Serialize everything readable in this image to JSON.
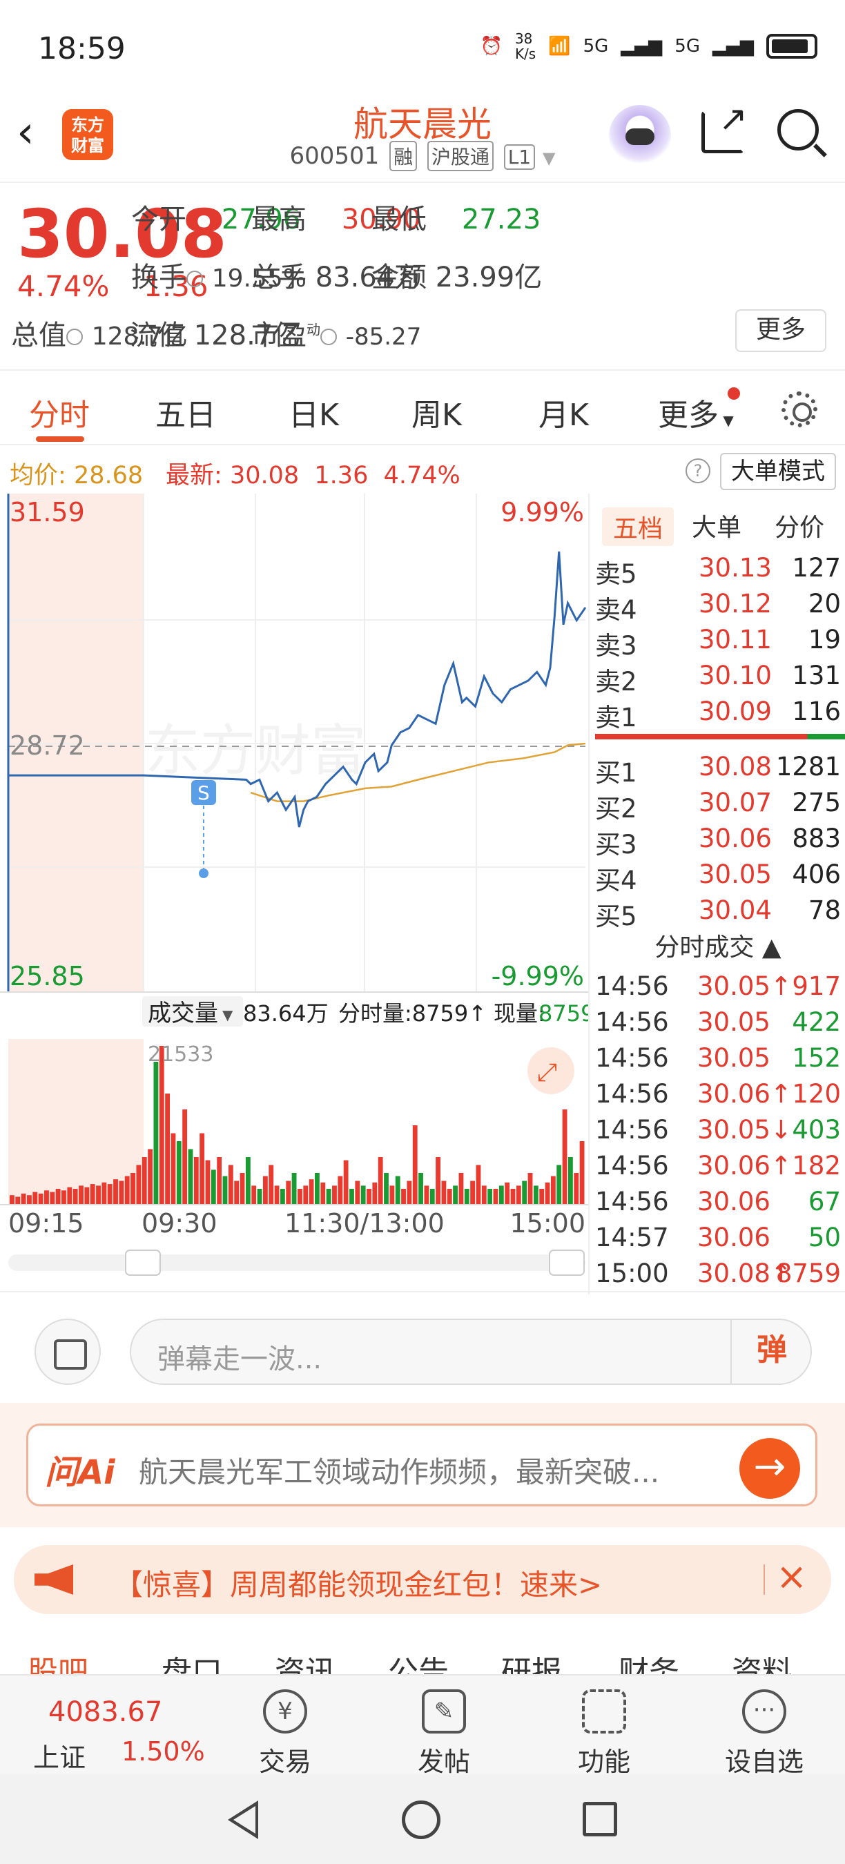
{
  "status": {
    "time": "18:59",
    "net_speed": "38\nK/s",
    "sim1": "5G",
    "sim2": "5G"
  },
  "header": {
    "logo_text": "东方\n财富",
    "title": "航天晨光",
    "code": "600501",
    "tags": [
      "融",
      "沪股通",
      "L1"
    ]
  },
  "quote": {
    "price": "30.08",
    "pct": "4.74%",
    "change": "1.36",
    "open_label": "今开",
    "open": "27.96",
    "high_label": "最高",
    "high": "30.90",
    "low_label": "最低",
    "low": "27.23",
    "turnover_label": "换手",
    "turnover": "19.55%",
    "volume_label": "总手",
    "volume": "83.64万",
    "amount_label": "金额",
    "amount": "23.99亿",
    "mcap_label": "总值",
    "mcap": "128.7亿",
    "float_label": "流值",
    "float": "128.7亿",
    "pe_label": "市盈",
    "pe_sup": "动",
    "pe": "-85.27",
    "more_label": "更多"
  },
  "tabs": {
    "items": [
      "分时",
      "五日",
      "日K",
      "周K",
      "月K",
      "更多"
    ],
    "active": "分时"
  },
  "avgbar": {
    "avg_label": "均价:",
    "avg": "28.68",
    "latest_label": "最新:",
    "latest": "30.08",
    "change": "1.36",
    "pct": "4.74%",
    "help": "?",
    "mode_label": "大单模式"
  },
  "chart_data": {
    "type": "line",
    "y_axis": {
      "top": "31.59",
      "mid": "28.72",
      "bottom": "25.85",
      "top_pct": "9.99%",
      "bottom_pct": "-9.99%"
    },
    "ylim": [
      25.85,
      31.59
    ],
    "prev_close": 28.72,
    "x_ticks": [
      "09:15",
      "09:30",
      "11:30/13:00",
      "15:00"
    ],
    "marker": "S",
    "watermark": "东方财富",
    "series": [
      {
        "name": "price",
        "x": [
          0,
          0.05,
          0.15,
          0.22,
          0.23,
          0.24,
          0.26,
          0.28,
          0.3,
          0.32,
          0.34,
          0.35,
          0.36,
          0.37,
          0.39,
          0.41,
          0.43,
          0.45,
          0.47,
          0.48,
          0.5,
          0.52,
          0.53,
          0.55,
          0.56,
          0.58,
          0.6,
          0.62,
          0.64,
          0.66,
          0.68,
          0.7,
          0.72,
          0.73,
          0.75,
          0.77,
          0.79,
          0.81,
          0.83,
          0.85,
          0.87,
          0.89,
          0.91,
          0.92,
          0.93,
          0.94,
          0.95,
          0.96,
          0.98,
          1.0
        ],
        "y": [
          28.35,
          28.35,
          28.35,
          28.35,
          28.3,
          28.25,
          28.3,
          28.05,
          28.15,
          27.95,
          28.1,
          27.75,
          27.95,
          28.05,
          28.1,
          28.25,
          28.35,
          28.45,
          28.3,
          28.25,
          28.5,
          28.6,
          28.4,
          28.5,
          28.7,
          28.85,
          28.9,
          29.05,
          29.0,
          28.95,
          29.4,
          29.65,
          29.2,
          29.25,
          29.15,
          29.5,
          29.3,
          29.2,
          29.35,
          29.4,
          29.45,
          29.55,
          29.4,
          29.6,
          30.2,
          30.95,
          30.1,
          30.35,
          30.15,
          30.3
        ]
      },
      {
        "name": "avg",
        "x": [
          0.24,
          0.3,
          0.36,
          0.42,
          0.5,
          0.56,
          0.62,
          0.7,
          0.78,
          0.86,
          0.93,
          0.96,
          1.0
        ],
        "y": [
          28.15,
          28.05,
          28.05,
          28.12,
          28.2,
          28.22,
          28.3,
          28.4,
          28.5,
          28.55,
          28.62,
          28.7,
          28.72
        ]
      }
    ]
  },
  "volume": {
    "label": "成交量",
    "total": "83.64万",
    "tick_label": "分时量:8759↑",
    "now_label": "现量:",
    "now": "8759",
    "peak": "21533",
    "bars": [
      0.06,
      0.05,
      0.07,
      0.06,
      0.08,
      0.07,
      0.09,
      0.08,
      0.1,
      0.09,
      0.11,
      0.1,
      0.12,
      0.11,
      0.13,
      0.12,
      0.14,
      0.13,
      0.16,
      0.15,
      0.18,
      0.2,
      0.25,
      0.3,
      0.35,
      0.9,
      1.0,
      0.7,
      0.45,
      0.4,
      0.6,
      0.35,
      0.3,
      0.45,
      0.28,
      0.22,
      0.3,
      0.18,
      0.25,
      0.15,
      0.2,
      0.3,
      0.12,
      0.1,
      0.18,
      0.25,
      0.12,
      0.1,
      0.15,
      0.2,
      0.1,
      0.12,
      0.16,
      0.2,
      0.14,
      0.1,
      0.12,
      0.18,
      0.28,
      0.1,
      0.15,
      0.12,
      0.1,
      0.14,
      0.3,
      0.2,
      0.12,
      0.18,
      0.1,
      0.15,
      0.5,
      0.2,
      0.12,
      0.1,
      0.3,
      0.15,
      0.1,
      0.12,
      0.2,
      0.1,
      0.15,
      0.25,
      0.12,
      0.1,
      0.1,
      0.12,
      0.14,
      0.1,
      0.12,
      0.15,
      0.2,
      0.12,
      0.1,
      0.14,
      0.18,
      0.25,
      0.6,
      0.3,
      0.2,
      0.4
    ]
  },
  "orderbook": {
    "tabs": [
      "五档",
      "大单",
      "分价"
    ],
    "asks": [
      {
        "l": "卖5",
        "p": "30.13",
        "v": "127"
      },
      {
        "l": "卖4",
        "p": "30.12",
        "v": "20"
      },
      {
        "l": "卖3",
        "p": "30.11",
        "v": "19"
      },
      {
        "l": "卖2",
        "p": "30.10",
        "v": "131"
      },
      {
        "l": "卖1",
        "p": "30.09",
        "v": "116"
      }
    ],
    "bids": [
      {
        "l": "买1",
        "p": "30.08",
        "v": "1281"
      },
      {
        "l": "买2",
        "p": "30.07",
        "v": "275"
      },
      {
        "l": "买3",
        "p": "30.06",
        "v": "883"
      },
      {
        "l": "买4",
        "p": "30.05",
        "v": "406"
      },
      {
        "l": "买5",
        "p": "30.04",
        "v": "78"
      }
    ],
    "trades_title": "分时成交",
    "trades": [
      {
        "t": "14:56",
        "p": "30.05↑",
        "v": "917",
        "c": "red"
      },
      {
        "t": "14:56",
        "p": "30.05",
        "v": "422",
        "c": "green"
      },
      {
        "t": "14:56",
        "p": "30.05",
        "v": "152",
        "c": "green"
      },
      {
        "t": "14:56",
        "p": "30.06↑",
        "v": "120",
        "c": "red"
      },
      {
        "t": "14:56",
        "p": "30.05↓",
        "v": "403",
        "c": "green"
      },
      {
        "t": "14:56",
        "p": "30.06↑",
        "v": "182",
        "c": "red"
      },
      {
        "t": "14:56",
        "p": "30.06",
        "v": "67",
        "c": "green"
      },
      {
        "t": "14:57",
        "p": "30.06",
        "v": "50",
        "c": "green"
      },
      {
        "t": "15:00",
        "p": "30.08↑",
        "v": "8759",
        "c": "red"
      }
    ]
  },
  "danmu": {
    "placeholder": "弹幕走一波...",
    "button": "弹"
  },
  "ask": {
    "logo": "问Ai",
    "text": "航天晨光军工领域动作频频，最新突破..."
  },
  "promo": {
    "text": "【惊喜】周周都能领现金红包！速来>"
  },
  "subtabs": [
    "股吧",
    "盘口",
    "资讯",
    "公告",
    "研报",
    "财务",
    "资料"
  ],
  "bottomnav": {
    "index_value": "4083.67",
    "index_name": "上证",
    "index_pct": "1.50%",
    "items": [
      "交易",
      "发帖",
      "功能",
      "设自选"
    ]
  }
}
